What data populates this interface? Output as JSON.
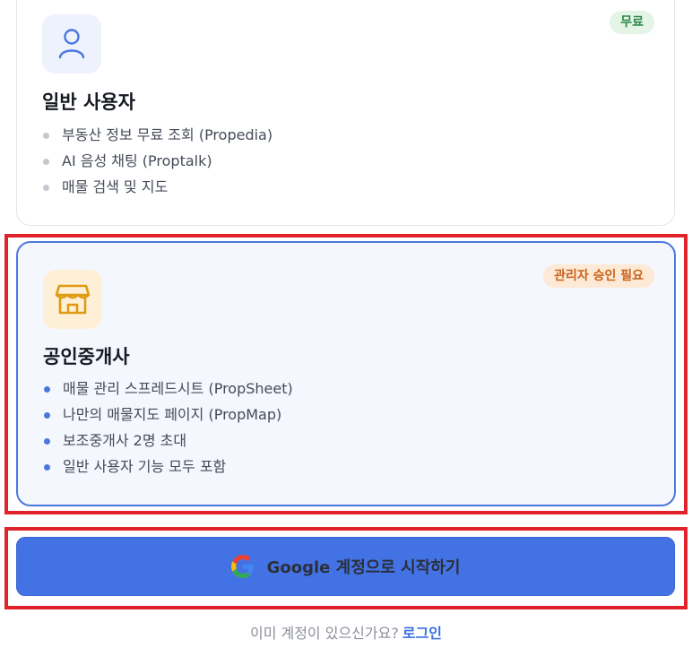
{
  "roles": {
    "general": {
      "badge": "무료",
      "title": "일반 사용자",
      "features": [
        "부동산 정보 무료 조회 (Propedia)",
        "AI 음성 채팅 (Proptalk)",
        "매물 검색 및 지도"
      ],
      "icon": "user-icon"
    },
    "broker": {
      "badge": "관리자 승인 필요",
      "title": "공인중개사",
      "features": [
        "매물 관리 스프레드시트 (PropSheet)",
        "나만의 매물지도 페이지 (PropMap)",
        "보조중개사 2명 초대",
        "일반 사용자 기능 모두 포함"
      ],
      "icon": "store-icon",
      "selected": true
    }
  },
  "google_button": {
    "label": "Google 계정으로 시작하기",
    "icon": "google-icon"
  },
  "footer": {
    "prompt": "이미 계정이 있으신가요?",
    "login_link": "로그인"
  },
  "colors": {
    "accent": "#4372e4",
    "selected_border": "#4b78df",
    "highlight": "#e0222b",
    "free_badge": "#2a8a45",
    "approval_badge": "#c9621a"
  }
}
